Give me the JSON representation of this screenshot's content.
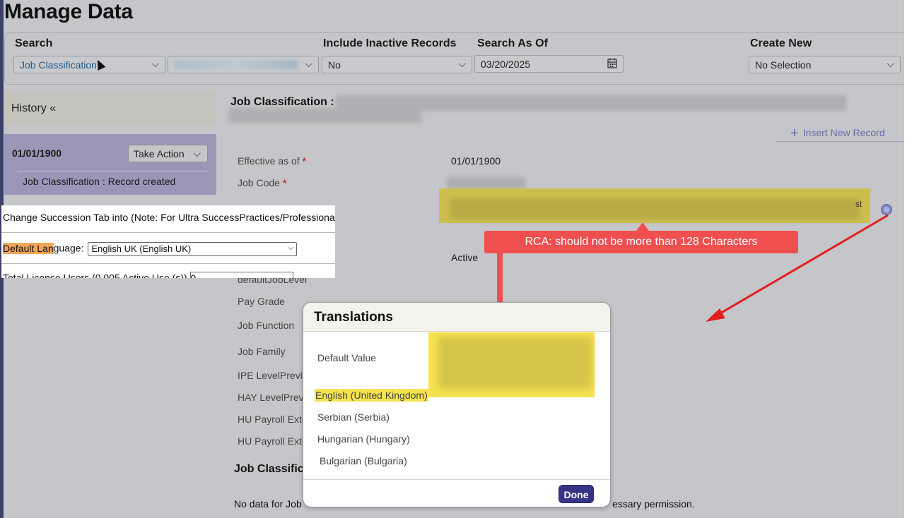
{
  "page_title": "Manage Data",
  "search": {
    "label": "Search",
    "object_type": "Job Classification",
    "include_inactive_label": "Include Inactive Records",
    "include_inactive_value": "No",
    "search_as_of_label": "Search As Of",
    "search_as_of_value": "03/20/2025",
    "create_new_label": "Create New",
    "create_new_value": "No Selection"
  },
  "history": {
    "title": "History «",
    "record_date": "01/01/1900",
    "take_action": "Take Action",
    "record_note": "Job Classification : Record created"
  },
  "form": {
    "header": "Job Classification :",
    "insert_new_record": "Insert New Record",
    "fields": {
      "effective_as_of": "Effective as of",
      "effective_value": "01/01/1900",
      "job_code": "Job Code",
      "status_value": "Active",
      "default_job_level": "defaultJobLevel",
      "pay_grade": "Pay Grade",
      "job_function": "Job Function",
      "job_family": "Job Family",
      "ipe_level": "IPE LevelPrevic",
      "hay_level": "HAY LevelPrevi",
      "hu_payroll_1": "HU Payroll Exte",
      "hu_payroll_2": "HU Payroll Exte"
    },
    "fragment_text": "st",
    "section_title": "Job Classific",
    "no_data_left": "No data for Job",
    "no_data_right": "essary permission."
  },
  "snippet": {
    "row1": "Change Succession Tab into (Note: For Ultra SuccessPractices/Professional Ed",
    "default_lang_hl": "Default Lan",
    "default_lang_rest": "guage:",
    "default_lang_value": "English UK (English UK)",
    "row3": "Total License Users (0.005 Active Use (s))",
    "row3_input": "0"
  },
  "annotation": {
    "rca": "RCA: should not be more than 128 Characters"
  },
  "translations_modal": {
    "title": "Translations",
    "default_value_label": "Default Value",
    "languages": [
      "English (United Kingdom)",
      "Serbian (Serbia)",
      "Hungarian (Hungary)",
      "Bulgarian (Bulgaria)"
    ],
    "done": "Done"
  },
  "colors": {
    "page_bg": "#c5c6c9",
    "highlight_yellow": "#f6e24f",
    "annotation_red": "#ef4f4f",
    "done_button": "#353486",
    "link_purple": "#6b6aa8"
  }
}
